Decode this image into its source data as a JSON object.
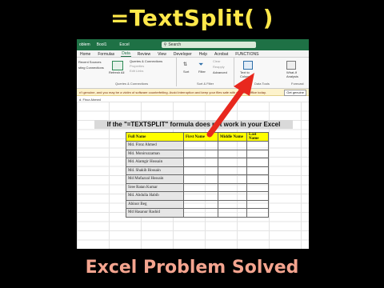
{
  "video_title": "=TextSplit( )",
  "video_footer": "Excel Problem Solved",
  "excel": {
    "titlebar": {
      "left": "oblem",
      "save": "Bool1",
      "app": "Excel"
    },
    "search_placeholder": "Search",
    "menu": [
      "Home",
      "Formulas",
      "Data",
      "Review",
      "View",
      "Developer",
      "Help",
      "Acrobat",
      "FUNCTIONS"
    ],
    "active_menu": "Data",
    "ribbon": {
      "left_items": [
        "Recent Sources",
        "sting Connections"
      ],
      "refresh_label": "Refresh All",
      "queries_items": [
        "Queries & Connections",
        "Properties",
        "Edit Links"
      ],
      "group_queries": "Queries & Connections",
      "sort_label": "Sort",
      "filter_label": "Filter",
      "clear_label": "Clear",
      "reapply_label": "Reapply",
      "advanced_label": "Advanced",
      "group_sort": "Sort & Filter",
      "text_to_columns": "Text to Columns",
      "group_data_tools": "Data Tools",
      "whatif_label": "What-If Analysis",
      "group_forecast": "Forecast"
    },
    "warning_text": "n't genuine, and you may be a victim of software counterfeiting. Avoid interruption and keep your files safe with genuine Office today.",
    "warning_button": "Get genuine",
    "formula_bar_text": "d. Firoz Ahmed"
  },
  "sheet": {
    "banner": "If the \"=TEXTSPLIT\" formula does not work in your Excel",
    "headers": [
      "Full Name",
      "First Name",
      "Middle Name",
      "Last Name"
    ],
    "rows": [
      "Md. Firoz Ahmed",
      "Md. Moniruzzaman",
      "Md. Alamgir Hossain",
      "Md. Shakib Hossain",
      "Md Mufazzal Hossain",
      "Sree Ratan Kumar",
      "Md. Abdulla Habib",
      "Abinor Beg",
      "Md Hasanur Rashid"
    ]
  },
  "colors": {
    "excel_green": "#1e7145",
    "header_yellow": "#ffff00",
    "arrow_red": "#e8281e",
    "title_yellow": "#ffe84a",
    "footer_salmon": "#f4a48f"
  }
}
